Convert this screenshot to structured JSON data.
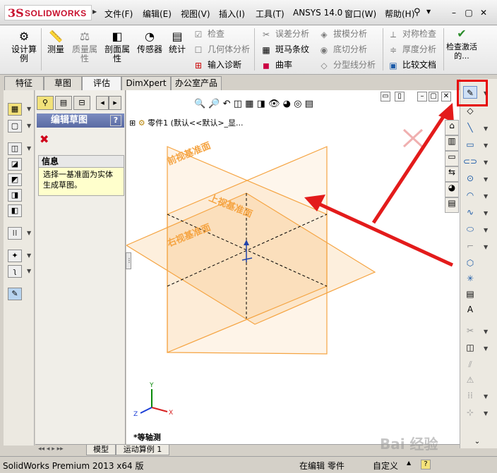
{
  "app": {
    "logo_prefix": "3S",
    "logo_name": "SOLIDWORKS"
  },
  "menu": [
    "文件(F)",
    "编辑(E)",
    "视图(V)",
    "插入(I)",
    "工具(T)",
    "ANSYS 14.0",
    "窗口(W)",
    "帮助(H)"
  ],
  "window_buttons": {
    "minimize": "–",
    "restore": "▢",
    "close": "✕"
  },
  "ribbon": {
    "large": [
      {
        "label": "设计算例",
        "icon": "design-study-icon"
      },
      {
        "label": "测量",
        "icon": "measure-icon"
      },
      {
        "label": "质量属性",
        "icon": "mass-properties-icon"
      },
      {
        "label": "剖面属性",
        "icon": "section-properties-icon"
      },
      {
        "label": "传感器",
        "icon": "sensor-icon"
      },
      {
        "label": "统计",
        "icon": "statistics-icon"
      }
    ],
    "col1": [
      "检查",
      "几何体分析",
      "输入诊断"
    ],
    "col2": [
      "误差分析",
      "斑马条纹",
      "曲率"
    ],
    "col3": [
      "拔模分析",
      "底切分析",
      "分型线分析"
    ],
    "col4": [
      "对称检查",
      "厚度分析",
      "比较文档"
    ],
    "check_active": "检查激活的..."
  },
  "tabs": [
    "特征",
    "草图",
    "评估",
    "DimXpert",
    "办公室产品"
  ],
  "panel": {
    "title": "编辑草图",
    "help": "?",
    "info_title": "信息",
    "info_text": "选择一基准面为实体生成草图。"
  },
  "graphics": {
    "tree_item": "零件1  (默认<<默认>_显...",
    "plane_front": "前视基准面",
    "plane_top": "上视基准面",
    "plane_right": "右视基准面",
    "view_label": "*等轴测",
    "triad_x": "X",
    "triad_y": "Y",
    "triad_z": "Z"
  },
  "bottom_tabs": [
    "模型",
    "运动算例 1"
  ],
  "status": {
    "product": "SolidWorks Premium 2013 x64 版",
    "editing": "在编辑 零件",
    "custom": "自定义",
    "help": "?"
  },
  "watermark": "Bai 经验",
  "colors": {
    "plane": "#f5a442",
    "highlight": "#e60000",
    "panel_header": "#6877b1"
  }
}
